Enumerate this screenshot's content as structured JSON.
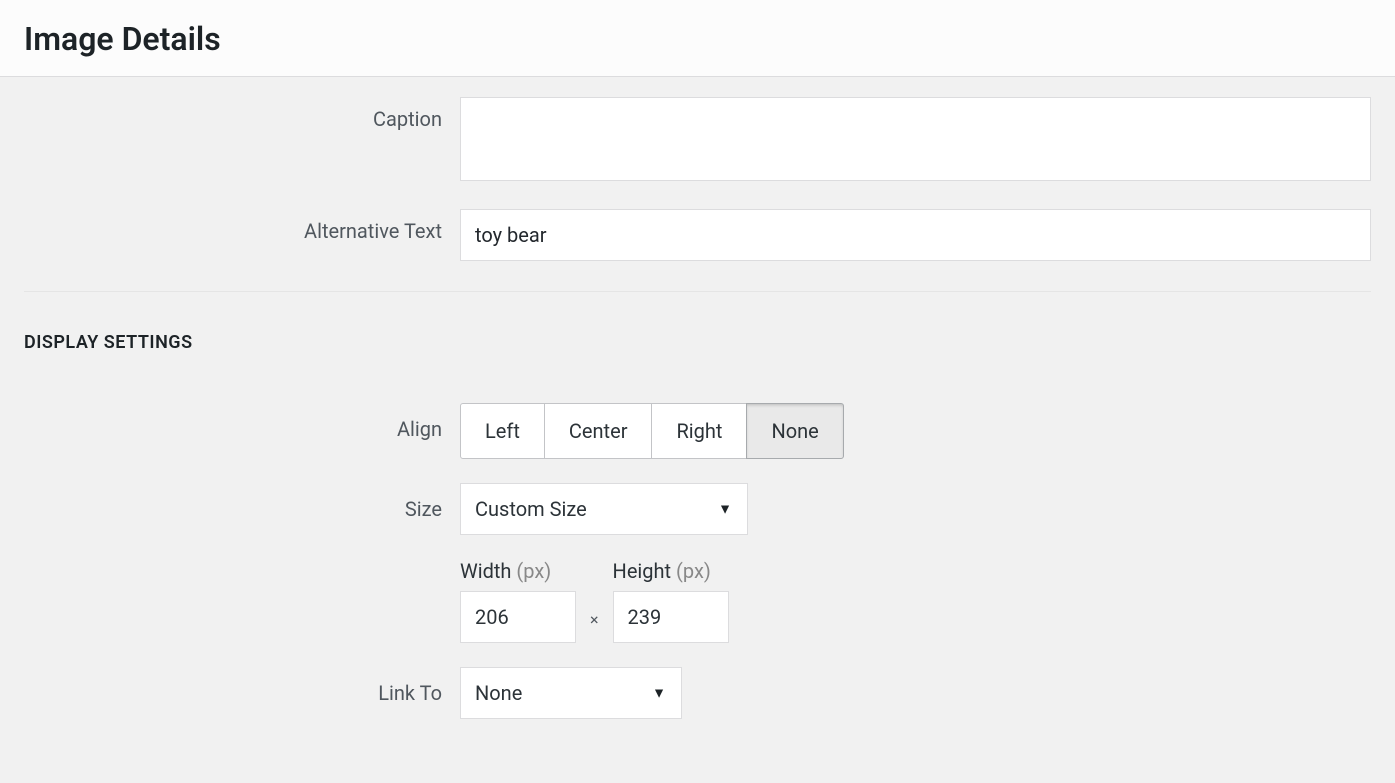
{
  "header": {
    "title": "Image Details"
  },
  "fields": {
    "caption": {
      "label": "Caption",
      "value": ""
    },
    "alt_text": {
      "label": "Alternative Text",
      "value": "toy bear"
    }
  },
  "display_settings": {
    "heading": "DISPLAY SETTINGS",
    "align": {
      "label": "Align",
      "options": {
        "left": "Left",
        "center": "Center",
        "right": "Right",
        "none": "None"
      },
      "selected": "none"
    },
    "size": {
      "label": "Size",
      "value": "Custom Size"
    },
    "dimensions": {
      "width_label": "Width",
      "height_label": "Height",
      "unit": "(px)",
      "width": "206",
      "height": "239",
      "separator": "×"
    },
    "link_to": {
      "label": "Link To",
      "value": "None"
    }
  }
}
